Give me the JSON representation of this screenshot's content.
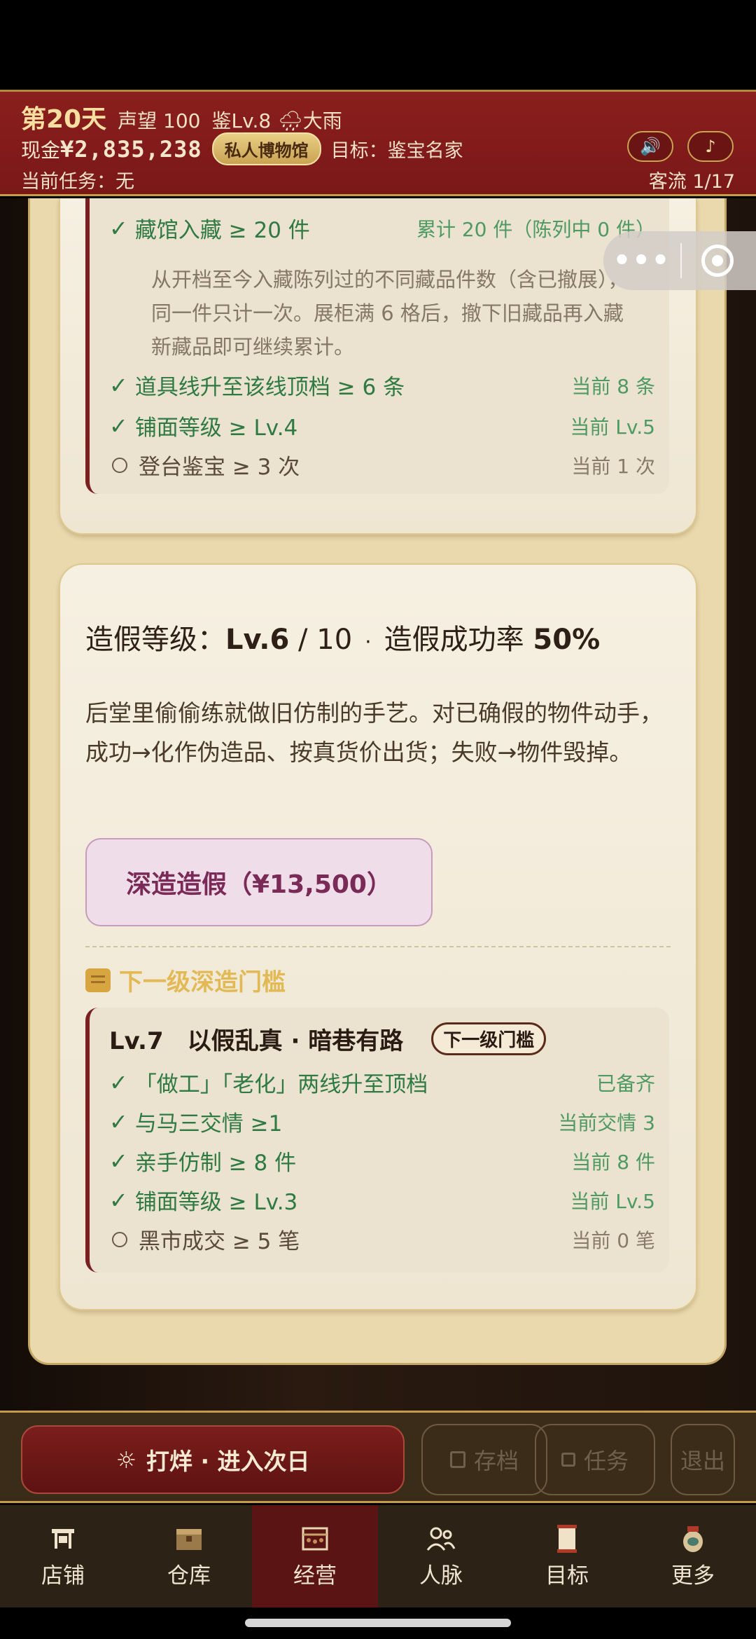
{
  "header": {
    "day": "第20天",
    "reputation": "声望 100",
    "appraisal_level": "鉴Lv.8",
    "weather_icon": "rain-cloud-icon",
    "weather": "大雨",
    "cash_label": "现金",
    "cash": "¥2,835,238",
    "museum_badge": "私人博物馆",
    "goal": "目标：鉴宝名家",
    "current_task": "当前任务：无",
    "visitor_flow": "客流 1/17",
    "sound_icon": "speaker-icon",
    "music_icon": "music-note-icon"
  },
  "capsule": {
    "more_icon": "more-dots-icon",
    "close_icon": "target-close-icon"
  },
  "museum_requirements": [
    {
      "status": "done",
      "label": "藏馆入藏 ≥ 20 件",
      "value": "累计 20 件（陈列中 0 件）"
    },
    {
      "status": "note",
      "label": "从开档至今入藏陈列过的不同藏品件数（含已撤展），同一件只计一次。展柜满 6 格后，撤下旧藏品再入藏新藏品即可继续累计。"
    },
    {
      "status": "done",
      "label": "道具线升至该线顶档 ≥ 6 条",
      "value": "当前 8 条"
    },
    {
      "status": "done",
      "label": "铺面等级 ≥ Lv.4",
      "value": "当前 Lv.5"
    },
    {
      "status": "pending",
      "label": "登台鉴宝 ≥ 3 次",
      "value": "当前 1 次"
    }
  ],
  "forge": {
    "level_label": "造假等级：",
    "level": "Lv.6",
    "level_max": "/ 10",
    "dot": "·",
    "rate_label": "造假成功率",
    "rate": "50%",
    "description": "后堂里偷偷练就做旧仿制的手艺。对已确假的物件动手，成功→化作伪造品、按真货价出货；失败→物件毁掉。",
    "deepen_button": "深造造假（¥13,500）",
    "next_header": "下一级深造门槛",
    "next_level": {
      "title": "Lv.7　以假乱真 · 暗巷有路",
      "badge": "下一级门槛",
      "requirements": [
        {
          "status": "done",
          "label": "「做工」「老化」两线升至顶档",
          "value": "已备齐"
        },
        {
          "status": "done",
          "label": "与马三交情 ≥1",
          "value": "当前交情 3"
        },
        {
          "status": "done",
          "label": "亲手仿制 ≥ 8 件",
          "value": "当前 8 件"
        },
        {
          "status": "done",
          "label": "铺面等级 ≥ Lv.3",
          "value": "当前 Lv.5"
        },
        {
          "status": "pending",
          "label": "黑市成交 ≥ 5 笔",
          "value": "当前 0 笔"
        }
      ]
    }
  },
  "actions": {
    "next_day": "打烊 · 进入次日",
    "next_day_icon": "sun-icon",
    "save": "存档",
    "save_icon": "floppy-disk-icon",
    "task": "任务",
    "task_icon": "task-square-icon",
    "exit": "退出"
  },
  "tabs": [
    {
      "label": "店铺",
      "icon": "shop-icon"
    },
    {
      "label": "仓库",
      "icon": "warehouse-crate-icon"
    },
    {
      "label": "经营",
      "icon": "abacus-icon",
      "active": true
    },
    {
      "label": "人脉",
      "icon": "people-icon"
    },
    {
      "label": "目标",
      "icon": "scroll-goal-icon"
    },
    {
      "label": "更多",
      "icon": "more-jar-icon"
    }
  ],
  "colors": {
    "header_red": "#8a1f1d",
    "gold": "#c9a453",
    "done_green": "#2f7a43",
    "active_tab": "#5a1414"
  }
}
